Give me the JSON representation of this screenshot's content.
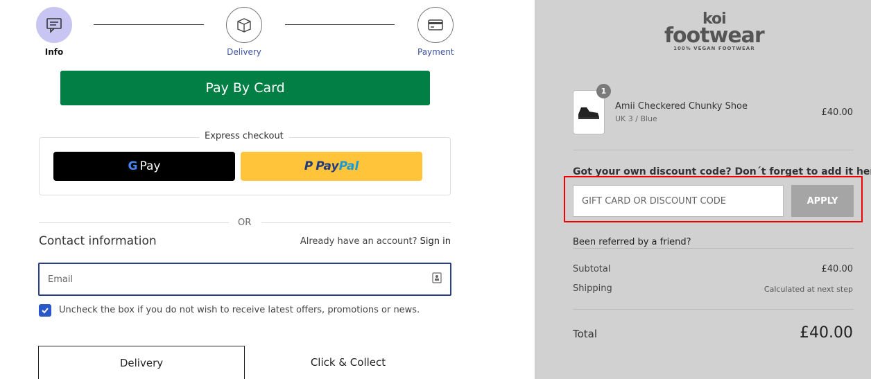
{
  "steps": [
    {
      "label": "Info",
      "icon": "chat-icon"
    },
    {
      "label": "Delivery",
      "icon": "box-icon"
    },
    {
      "label": "Payment",
      "icon": "card-icon"
    }
  ],
  "pay_by_card": "Pay By Card",
  "express": {
    "title": "Express checkout",
    "gpay": "Pay",
    "paypal_a": "Pay",
    "paypal_b": "Pal"
  },
  "or_text": "OR",
  "contact": {
    "title": "Contact information",
    "account_text": "Already have an account?",
    "sign_in": "Sign in",
    "email_placeholder": "Email",
    "marketing_text": "Uncheck the box if you do not wish to receive latest offers, promotions or news."
  },
  "tabs": {
    "delivery": "Delivery",
    "collect": "Click & Collect"
  },
  "logo": {
    "line1": "koi",
    "line2": "footwear",
    "tagline": "100% VEGAN FOOTWEAR"
  },
  "product": {
    "qty": "1",
    "name": "Amii Checkered Chunky Shoe",
    "variant": "UK 3 / Blue",
    "price": "£40.00"
  },
  "discount": {
    "title": "Got your own discount code? Don´t forget to add it here",
    "placeholder": "GIFT CARD OR DISCOUNT CODE",
    "apply": "APPLY"
  },
  "referred": "Been referred by a friend?",
  "summary": {
    "subtotal_label": "Subtotal",
    "subtotal": "£40.00",
    "shipping_label": "Shipping",
    "shipping": "Calculated at next step",
    "total_label": "Total",
    "total": "£40.00"
  },
  "colors": {
    "pay_card": "#017f45",
    "paypal": "#ffc439",
    "active_step": "#c9c5f2",
    "checkbox": "#2b56c8"
  }
}
